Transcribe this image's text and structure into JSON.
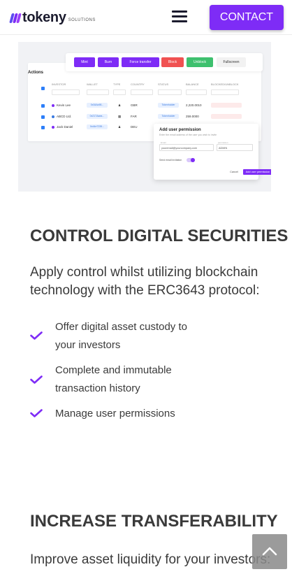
{
  "brand": {
    "name": "tokeny",
    "sub": "SOLUTIONS",
    "colors": {
      "primary": "#7e2cf6",
      "stripe1": "#7e2cf6",
      "stripe2": "#5b4cf0",
      "stripe3": "#9b3ef8"
    }
  },
  "header": {
    "menu_icon": "hamburger-icon",
    "contact_label": "CONTACT"
  },
  "mock": {
    "toolbar": [
      {
        "label": "Mint",
        "color": "#7e2cf6"
      },
      {
        "label": "Burn",
        "color": "#7e2cf6"
      },
      {
        "label": "Force transfer",
        "color": "#7e2cf6"
      },
      {
        "label": "Block",
        "color": "#f05151"
      },
      {
        "label": "Unblock",
        "color": "#3ec06e"
      },
      {
        "label": "Fullscreen",
        "color": "#f2f2f2"
      }
    ],
    "actions_title": "Actions",
    "columns": [
      "INVESTOR",
      "WALLET",
      "TYPE",
      "COUNTRY",
      "STATUS",
      "BALANCE",
      "BLOCKED/UNBLOCK"
    ],
    "rows": [
      {
        "investor": "Kevin Lee",
        "wallet": "0x34Ac98...",
        "country": "GBR",
        "status": "Tokenholder",
        "balance": "2,220.0010",
        "dot": "#7e2cf6"
      },
      {
        "investor": "ABCD Ltd.",
        "wallet": "0x217Aaea...",
        "country": "FAR",
        "status": "Tokenholder",
        "balance": "259.0000",
        "dot": "#3a7ae0"
      },
      {
        "investor": "Jack Daniel",
        "wallet": "0x44e7235...",
        "country": "DEU",
        "status": "",
        "balance": "",
        "dot": "#7e2cf6"
      }
    ],
    "modal": {
      "title": "Add user permission",
      "subtitle": "Enter the email address of the user you wish to invite",
      "email_label": "Email",
      "email_value": "youremail@yourcompany.com",
      "perm_label": "permission",
      "perm_value": "ADMIN",
      "toggle_label": "Send email invitation",
      "cancel_label": "Cancel",
      "submit_label": "Add user permission"
    }
  },
  "section1": {
    "title": "CONTROL DIGITAL SECURITIES",
    "lead": "Apply control whilst utilizing blockchain technology with the ERC3643 protocol:",
    "items": [
      "Offer digital asset custody to your investors",
      "Complete and immutable transaction history",
      "Manage user permissions"
    ]
  },
  "section2": {
    "title": "INCREASE TRANSFERABILITY",
    "lead": "Improve asset liquidity for your investors:"
  },
  "back_to_top_icon": "chevron-up-icon"
}
